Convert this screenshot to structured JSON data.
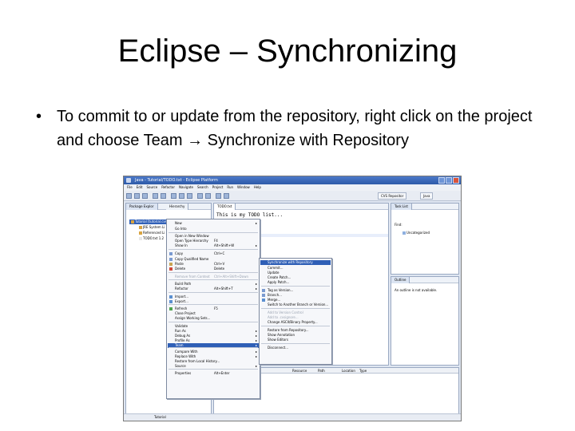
{
  "slide": {
    "title": "Eclipse – Synchronizing",
    "bullet_marker": "•",
    "bullet_text": "To commit to or update from the repository, right click on the project and choose Team → Synchronize with Repository"
  },
  "window": {
    "title": "Java - Tutorial/TODO.txt - Eclipse Platform"
  },
  "menubar": [
    "File",
    "Edit",
    "Source",
    "Refactor",
    "Navigate",
    "Search",
    "Project",
    "Run",
    "Window",
    "Help"
  ],
  "perspectives": {
    "cvs": "CVS Repositor",
    "java": "Java"
  },
  "package_explorer": {
    "tab": "Package Explor",
    "tab2": "Hierarchy",
    "rows": [
      "Tutorial [tutorial.cvs]",
      "JRE System Li",
      "Referenced Li",
      "TODO.txt 1.2"
    ]
  },
  "editor": {
    "tab": "TODO.txt",
    "line1": "This is my TODO list..."
  },
  "task_list": {
    "tab": "Task List",
    "find": "Find:",
    "category": "Uncategorized"
  },
  "outline": {
    "tab": "Outline",
    "message": "An outline is not available."
  },
  "problems": {
    "headers": [
      "Resource",
      "Path",
      "Location",
      "Type"
    ]
  },
  "status": {
    "left": "Tutorial"
  },
  "context_menu": {
    "items": [
      {
        "label": "New",
        "arrow": "▸"
      },
      {
        "label": "Go Into"
      },
      {
        "label": "Open in New Window"
      },
      {
        "label": "Open Type Hierarchy",
        "shortcut": "F4"
      },
      {
        "label": "Show In",
        "shortcut": "Alt+Shift+W",
        "arrow": "▸"
      },
      {
        "label": "Copy",
        "shortcut": "Ctrl+C"
      },
      {
        "label": "Copy Qualified Name"
      },
      {
        "label": "Paste",
        "shortcut": "Ctrl+V"
      },
      {
        "label": "Delete",
        "shortcut": "Delete"
      },
      {
        "label": "Remove from Context",
        "shortcut": "Ctrl+Alt+Shift+Down"
      },
      {
        "label": "Build Path",
        "arrow": "▸"
      },
      {
        "label": "Refactor",
        "shortcut": "Alt+Shift+T",
        "arrow": "▸"
      },
      {
        "label": "Import..."
      },
      {
        "label": "Export..."
      },
      {
        "label": "Refresh",
        "shortcut": "F5"
      },
      {
        "label": "Close Project"
      },
      {
        "label": "Assign Working Sets..."
      },
      {
        "label": "Validate"
      },
      {
        "label": "Run As",
        "arrow": "▸"
      },
      {
        "label": "Debug As",
        "arrow": "▸"
      },
      {
        "label": "Profile As",
        "arrow": "▸"
      },
      {
        "label": "Team",
        "arrow": "▸"
      },
      {
        "label": "Compare With",
        "arrow": "▸"
      },
      {
        "label": "Replace With",
        "arrow": "▸"
      },
      {
        "label": "Restore from Local History..."
      },
      {
        "label": "Source",
        "arrow": "▸"
      },
      {
        "label": "Properties",
        "shortcut": "Alt+Enter"
      }
    ]
  },
  "team_menu": {
    "items": [
      {
        "label": "Synchronize with Repository"
      },
      {
        "label": "Commit..."
      },
      {
        "label": "Update"
      },
      {
        "label": "Create Patch..."
      },
      {
        "label": "Apply Patch..."
      },
      {
        "label": "Tag as Version..."
      },
      {
        "label": "Branch..."
      },
      {
        "label": "Merge..."
      },
      {
        "label": "Switch to Another Branch or Version..."
      },
      {
        "label": "Add to Version Control"
      },
      {
        "label": "Add to .cvsignore..."
      },
      {
        "label": "Change ASCII/Binary Property..."
      },
      {
        "label": "Restore from Repository..."
      },
      {
        "label": "Show Annotation"
      },
      {
        "label": "Show Editors"
      },
      {
        "label": "Disconnect..."
      }
    ]
  }
}
